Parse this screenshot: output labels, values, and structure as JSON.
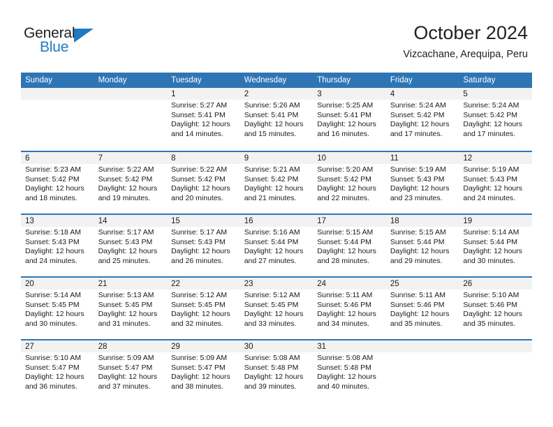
{
  "logo": {
    "word_top": "General",
    "word_bottom": "Blue",
    "brand_color": "#1f7bc1",
    "text_color": "#231f20",
    "triangle_icon": "triangle-icon"
  },
  "header": {
    "title": "October 2024",
    "subtitle": "Vizcachane, Arequipa, Peru"
  },
  "colors": {
    "header_blue": "#2e75b6",
    "daynum_band": "#f2f2f2",
    "text": "#1a1a1a"
  },
  "calendar": {
    "weekdays": [
      "Sunday",
      "Monday",
      "Tuesday",
      "Wednesday",
      "Thursday",
      "Friday",
      "Saturday"
    ],
    "weeks": [
      [
        {
          "day": "",
          "lines": [
            "",
            "",
            "",
            ""
          ],
          "blank": true
        },
        {
          "day": "",
          "lines": [
            "",
            "",
            "",
            ""
          ],
          "blank": true
        },
        {
          "day": "1",
          "lines": [
            "Sunrise: 5:27 AM",
            "Sunset: 5:41 PM",
            "Daylight: 12 hours",
            "and 14 minutes."
          ]
        },
        {
          "day": "2",
          "lines": [
            "Sunrise: 5:26 AM",
            "Sunset: 5:41 PM",
            "Daylight: 12 hours",
            "and 15 minutes."
          ]
        },
        {
          "day": "3",
          "lines": [
            "Sunrise: 5:25 AM",
            "Sunset: 5:41 PM",
            "Daylight: 12 hours",
            "and 16 minutes."
          ]
        },
        {
          "day": "4",
          "lines": [
            "Sunrise: 5:24 AM",
            "Sunset: 5:42 PM",
            "Daylight: 12 hours",
            "and 17 minutes."
          ]
        },
        {
          "day": "5",
          "lines": [
            "Sunrise: 5:24 AM",
            "Sunset: 5:42 PM",
            "Daylight: 12 hours",
            "and 17 minutes."
          ]
        }
      ],
      [
        {
          "day": "6",
          "lines": [
            "Sunrise: 5:23 AM",
            "Sunset: 5:42 PM",
            "Daylight: 12 hours",
            "and 18 minutes."
          ]
        },
        {
          "day": "7",
          "lines": [
            "Sunrise: 5:22 AM",
            "Sunset: 5:42 PM",
            "Daylight: 12 hours",
            "and 19 minutes."
          ]
        },
        {
          "day": "8",
          "lines": [
            "Sunrise: 5:22 AM",
            "Sunset: 5:42 PM",
            "Daylight: 12 hours",
            "and 20 minutes."
          ]
        },
        {
          "day": "9",
          "lines": [
            "Sunrise: 5:21 AM",
            "Sunset: 5:42 PM",
            "Daylight: 12 hours",
            "and 21 minutes."
          ]
        },
        {
          "day": "10",
          "lines": [
            "Sunrise: 5:20 AM",
            "Sunset: 5:42 PM",
            "Daylight: 12 hours",
            "and 22 minutes."
          ]
        },
        {
          "day": "11",
          "lines": [
            "Sunrise: 5:19 AM",
            "Sunset: 5:43 PM",
            "Daylight: 12 hours",
            "and 23 minutes."
          ]
        },
        {
          "day": "12",
          "lines": [
            "Sunrise: 5:19 AM",
            "Sunset: 5:43 PM",
            "Daylight: 12 hours",
            "and 24 minutes."
          ]
        }
      ],
      [
        {
          "day": "13",
          "lines": [
            "Sunrise: 5:18 AM",
            "Sunset: 5:43 PM",
            "Daylight: 12 hours",
            "and 24 minutes."
          ]
        },
        {
          "day": "14",
          "lines": [
            "Sunrise: 5:17 AM",
            "Sunset: 5:43 PM",
            "Daylight: 12 hours",
            "and 25 minutes."
          ]
        },
        {
          "day": "15",
          "lines": [
            "Sunrise: 5:17 AM",
            "Sunset: 5:43 PM",
            "Daylight: 12 hours",
            "and 26 minutes."
          ]
        },
        {
          "day": "16",
          "lines": [
            "Sunrise: 5:16 AM",
            "Sunset: 5:44 PM",
            "Daylight: 12 hours",
            "and 27 minutes."
          ]
        },
        {
          "day": "17",
          "lines": [
            "Sunrise: 5:15 AM",
            "Sunset: 5:44 PM",
            "Daylight: 12 hours",
            "and 28 minutes."
          ]
        },
        {
          "day": "18",
          "lines": [
            "Sunrise: 5:15 AM",
            "Sunset: 5:44 PM",
            "Daylight: 12 hours",
            "and 29 minutes."
          ]
        },
        {
          "day": "19",
          "lines": [
            "Sunrise: 5:14 AM",
            "Sunset: 5:44 PM",
            "Daylight: 12 hours",
            "and 30 minutes."
          ]
        }
      ],
      [
        {
          "day": "20",
          "lines": [
            "Sunrise: 5:14 AM",
            "Sunset: 5:45 PM",
            "Daylight: 12 hours",
            "and 30 minutes."
          ]
        },
        {
          "day": "21",
          "lines": [
            "Sunrise: 5:13 AM",
            "Sunset: 5:45 PM",
            "Daylight: 12 hours",
            "and 31 minutes."
          ]
        },
        {
          "day": "22",
          "lines": [
            "Sunrise: 5:12 AM",
            "Sunset: 5:45 PM",
            "Daylight: 12 hours",
            "and 32 minutes."
          ]
        },
        {
          "day": "23",
          "lines": [
            "Sunrise: 5:12 AM",
            "Sunset: 5:45 PM",
            "Daylight: 12 hours",
            "and 33 minutes."
          ]
        },
        {
          "day": "24",
          "lines": [
            "Sunrise: 5:11 AM",
            "Sunset: 5:46 PM",
            "Daylight: 12 hours",
            "and 34 minutes."
          ]
        },
        {
          "day": "25",
          "lines": [
            "Sunrise: 5:11 AM",
            "Sunset: 5:46 PM",
            "Daylight: 12 hours",
            "and 35 minutes."
          ]
        },
        {
          "day": "26",
          "lines": [
            "Sunrise: 5:10 AM",
            "Sunset: 5:46 PM",
            "Daylight: 12 hours",
            "and 35 minutes."
          ]
        }
      ],
      [
        {
          "day": "27",
          "lines": [
            "Sunrise: 5:10 AM",
            "Sunset: 5:47 PM",
            "Daylight: 12 hours",
            "and 36 minutes."
          ]
        },
        {
          "day": "28",
          "lines": [
            "Sunrise: 5:09 AM",
            "Sunset: 5:47 PM",
            "Daylight: 12 hours",
            "and 37 minutes."
          ]
        },
        {
          "day": "29",
          "lines": [
            "Sunrise: 5:09 AM",
            "Sunset: 5:47 PM",
            "Daylight: 12 hours",
            "and 38 minutes."
          ]
        },
        {
          "day": "30",
          "lines": [
            "Sunrise: 5:08 AM",
            "Sunset: 5:48 PM",
            "Daylight: 12 hours",
            "and 39 minutes."
          ]
        },
        {
          "day": "31",
          "lines": [
            "Sunrise: 5:08 AM",
            "Sunset: 5:48 PM",
            "Daylight: 12 hours",
            "and 40 minutes."
          ]
        },
        {
          "day": "",
          "lines": [
            "",
            "",
            "",
            ""
          ],
          "blank": true
        },
        {
          "day": "",
          "lines": [
            "",
            "",
            "",
            ""
          ],
          "blank": true
        }
      ]
    ]
  }
}
